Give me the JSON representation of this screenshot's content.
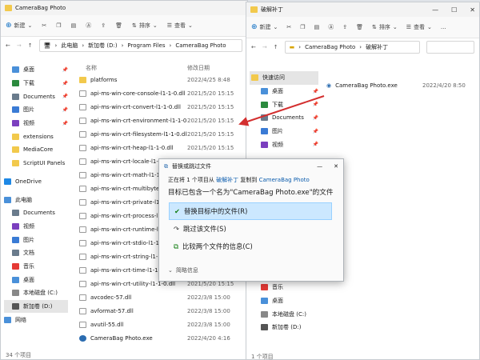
{
  "left_window": {
    "title": "CameraBag Photo",
    "toolbar": {
      "new": "新建",
      "sort": "排序",
      "view": "查看",
      "more": "..."
    },
    "address": [
      "此电脑",
      "新加卷 (D:)",
      "Program Files",
      "CameraBag Photo"
    ],
    "column_name": "名称",
    "column_date": "修改日期",
    "sidebar": [
      "桌面",
      "下载",
      "Documents",
      "图片",
      "视频",
      "extensions",
      "MediaCore",
      "ScriptUI Panels",
      "OneDrive",
      "此电脑",
      "Documents",
      "视频",
      "图片",
      "文档",
      "音乐",
      "桌面",
      "本地磁盘 (C:)",
      "新加卷 (D:)",
      "网络"
    ],
    "files": [
      {
        "name": "platforms",
        "date": "2022/4/25 8:48",
        "type": "folder"
      },
      {
        "name": "api-ms-win-core-console-l1-1-0.dll",
        "date": "2021/5/20 15:15",
        "type": "dll"
      },
      {
        "name": "api-ms-win-crt-convert-l1-1-0.dll",
        "date": "2021/5/20 15:15",
        "type": "dll"
      },
      {
        "name": "api-ms-win-crt-environment-l1-1-0.dll",
        "date": "2021/5/20 15:15",
        "type": "dll"
      },
      {
        "name": "api-ms-win-crt-filesystem-l1-1-0.dll",
        "date": "2021/5/20 15:15",
        "type": "dll"
      },
      {
        "name": "api-ms-win-crt-heap-l1-1-0.dll",
        "date": "2021/5/20 15:15",
        "type": "dll"
      },
      {
        "name": "api-ms-win-crt-locale-l1-1-0.dll",
        "date": "",
        "type": "dll"
      },
      {
        "name": "api-ms-win-crt-math-l1-1-0.dll",
        "date": "",
        "type": "dll"
      },
      {
        "name": "api-ms-win-crt-multibyte-l1-1-0.dll",
        "date": "",
        "type": "dll"
      },
      {
        "name": "api-ms-win-crt-private-l1-1-0.dll",
        "date": "",
        "type": "dll"
      },
      {
        "name": "api-ms-win-crt-process-l1-1-0.dll",
        "date": "",
        "type": "dll"
      },
      {
        "name": "api-ms-win-crt-runtime-l1-1-0.dll",
        "date": "",
        "type": "dll"
      },
      {
        "name": "api-ms-win-crt-stdio-l1-1-0.dll",
        "date": "",
        "type": "dll"
      },
      {
        "name": "api-ms-win-crt-string-l1-1-0.dll",
        "date": "",
        "type": "dll"
      },
      {
        "name": "api-ms-win-crt-time-l1-1-0.dll",
        "date": "",
        "type": "dll"
      },
      {
        "name": "api-ms-win-crt-utility-l1-1-0.dll",
        "date": "2021/5/20 15:15",
        "type": "dll"
      },
      {
        "name": "avcodec-57.dll",
        "date": "2022/3/8 15:00",
        "type": "dll"
      },
      {
        "name": "avformat-57.dll",
        "date": "2022/3/8 15:00",
        "type": "dll"
      },
      {
        "name": "avutil-55.dll",
        "date": "2022/3/8 15:00",
        "type": "dll"
      },
      {
        "name": "CameraBag Photo.exe",
        "date": "2022/4/20 4:16",
        "type": "exe"
      }
    ],
    "status": "34 个项目"
  },
  "right_window": {
    "title": "破解补丁",
    "toolbar": {
      "new": "新建",
      "sort": "排序",
      "view": "查看",
      "more": "..."
    },
    "address": [
      "CameraBag Photo",
      "破解补丁"
    ],
    "sidebar": [
      "快速访问",
      "桌面",
      "下载",
      "Documents",
      "图片",
      "视频",
      "下载",
      "音乐",
      "桌面",
      "本地磁盘 (C:)",
      "新加卷 (D:)"
    ],
    "files": [
      {
        "name": "CameraBag Photo.exe",
        "date": "2022/4/20 8:50"
      }
    ],
    "status": "1 个项目"
  },
  "dialog": {
    "title": "替换或跳过文件",
    "copy_prefix": "正在将 1 个项目从",
    "copy_source": "破解补丁",
    "copy_middle": "复制到",
    "copy_dest": "CameraBag Photo",
    "heading": "目标已包含一个名为\"CameraBag Photo.exe\"的文件",
    "options": [
      "替换目标中的文件(R)",
      "跳过该文件(S)",
      "比较两个文件的信息(C)"
    ],
    "details": "简略信息"
  },
  "colors": {
    "arrow": "#d32f2f",
    "selection": "#cce8ff",
    "link": "#0b5cad",
    "folder": "#f2c94c"
  }
}
